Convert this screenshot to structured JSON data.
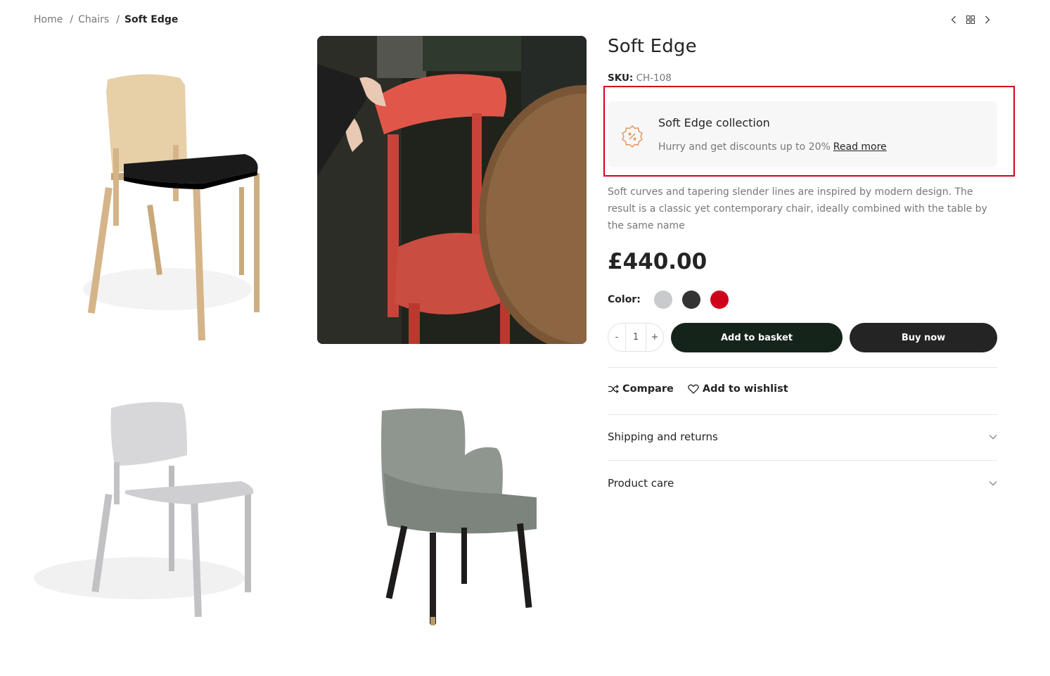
{
  "breadcrumb": {
    "items": [
      "Home",
      "Chairs"
    ],
    "separator": "/",
    "current": "Soft Edge"
  },
  "product": {
    "title": "Soft Edge",
    "sku_label": "SKU:",
    "sku_value": "CH-108",
    "promo": {
      "title": "Soft Edge collection",
      "text": "Hurry and get discounts up to 20%",
      "link": "Read more",
      "icon": "discount-badge-icon",
      "accent": "#e8925a"
    },
    "description": "Soft curves and tapering slender lines are inspired by modern design. The result is a classic yet contemporary chair, ideally combined with the table by the same name",
    "price": "£440.00",
    "color_label": "Color:",
    "colors": [
      "#c9cacc",
      "#333333",
      "#d0021b"
    ],
    "quantity": {
      "minus": "-",
      "value": "1",
      "plus": "+"
    },
    "add_to_basket": "Add to basket",
    "buy_now": "Buy now",
    "compare": "Compare",
    "wishlist": "Add to wishlist",
    "accordions": [
      "Shipping and returns",
      "Product care"
    ]
  }
}
